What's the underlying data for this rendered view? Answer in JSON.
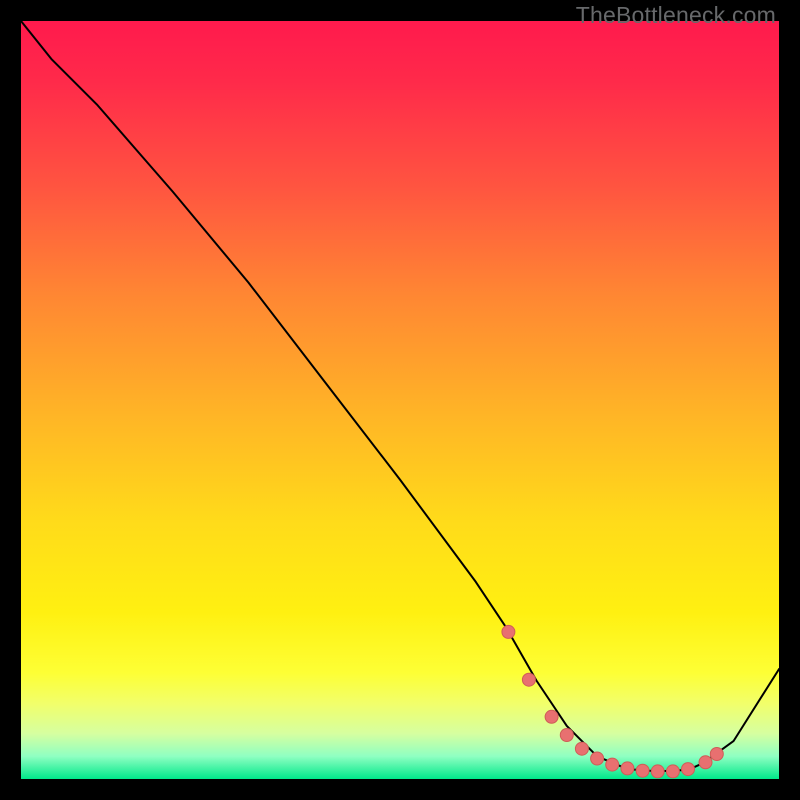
{
  "watermark": "TheBottleneck.com",
  "colors": {
    "curve": "#000000",
    "marker_fill": "#e87070",
    "marker_stroke": "#cf5d57"
  },
  "chart_data": {
    "type": "line",
    "title": "",
    "xlabel": "",
    "ylabel": "",
    "xlim": [
      0,
      100
    ],
    "ylim": [
      0,
      100
    ],
    "series": [
      {
        "name": "curve",
        "x": [
          0,
          4,
          10,
          20,
          30,
          40,
          50,
          60,
          64,
          68,
          72,
          76,
          80,
          84,
          88,
          90,
          94,
          100
        ],
        "values": [
          100,
          95,
          89,
          77.5,
          65.5,
          52.5,
          39.5,
          26,
          20,
          13,
          7,
          3,
          1.3,
          1,
          1.2,
          2.1,
          5,
          14.5
        ]
      }
    ],
    "markers": {
      "x": [
        64.3,
        67.0,
        70.0,
        72.0,
        74.0,
        76.0,
        78.0,
        80.0,
        82.0,
        84.0,
        86.0,
        88.0,
        90.3,
        91.8
      ],
      "y": [
        19.4,
        13.1,
        8.2,
        5.8,
        4.0,
        2.7,
        1.9,
        1.4,
        1.1,
        1.0,
        1.0,
        1.3,
        2.2,
        3.3
      ]
    }
  }
}
